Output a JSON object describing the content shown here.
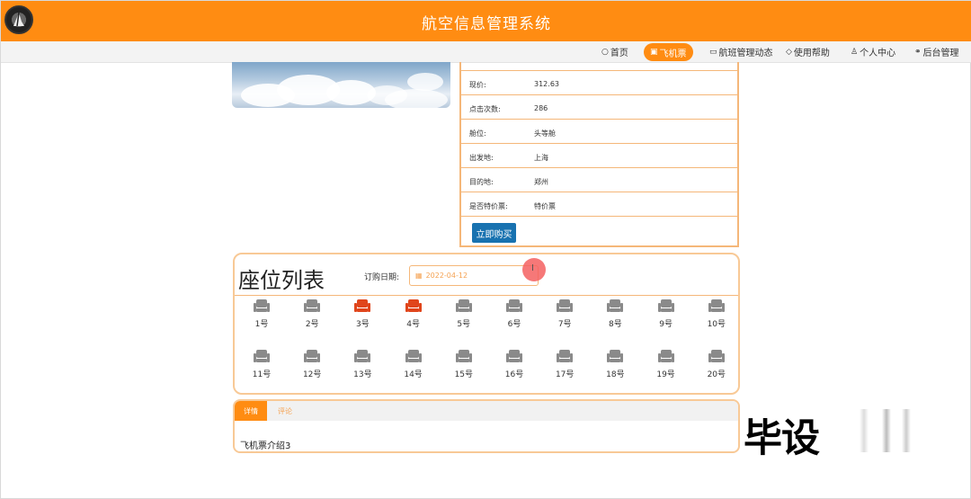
{
  "header": {
    "title": "航空信息管理系统",
    "brand_color": "#ff8c12"
  },
  "nav": {
    "items": [
      {
        "label": "首页",
        "icon": "home-icon"
      },
      {
        "label": "飞机票",
        "icon": "ticket-icon",
        "active": true
      },
      {
        "label": "航班管理动态",
        "icon": "mail-icon"
      },
      {
        "label": "使用帮助",
        "icon": "tag-icon"
      },
      {
        "label": "个人中心",
        "icon": "user-icon"
      },
      {
        "label": "后台管理",
        "icon": "link-icon"
      }
    ]
  },
  "ticket": {
    "rows": [
      {
        "key": "现价:",
        "value": "312.63"
      },
      {
        "key": "点击次数:",
        "value": "286"
      },
      {
        "key": "舱位:",
        "value": "头等舱"
      },
      {
        "key": "出发地:",
        "value": "上海"
      },
      {
        "key": "目的地:",
        "value": "郑州"
      },
      {
        "key": "是否特价票:",
        "value": "特价票"
      }
    ],
    "buy_label": "立即购买",
    "buy_color": "#1872b0"
  },
  "seats": {
    "title": "座位列表",
    "date_label": "订购日期:",
    "date_value": "2022-04-12",
    "available_color": "#8a8a8a",
    "taken_color": "#e0451b",
    "cursor_glyph": "I",
    "items": [
      {
        "label": "1号",
        "taken": false
      },
      {
        "label": "2号",
        "taken": false
      },
      {
        "label": "3号",
        "taken": true
      },
      {
        "label": "4号",
        "taken": true
      },
      {
        "label": "5号",
        "taken": false
      },
      {
        "label": "6号",
        "taken": false
      },
      {
        "label": "7号",
        "taken": false
      },
      {
        "label": "8号",
        "taken": false
      },
      {
        "label": "9号",
        "taken": false
      },
      {
        "label": "10号",
        "taken": false
      },
      {
        "label": "11号",
        "taken": false
      },
      {
        "label": "12号",
        "taken": false
      },
      {
        "label": "13号",
        "taken": false
      },
      {
        "label": "14号",
        "taken": false
      },
      {
        "label": "15号",
        "taken": false
      },
      {
        "label": "16号",
        "taken": false
      },
      {
        "label": "17号",
        "taken": false
      },
      {
        "label": "18号",
        "taken": false
      },
      {
        "label": "19号",
        "taken": false
      },
      {
        "label": "20号",
        "taken": false
      }
    ]
  },
  "detail": {
    "tabs": [
      {
        "label": "详情",
        "active": true
      },
      {
        "label": "评论",
        "active": false
      }
    ],
    "content": "飞机票介绍3"
  },
  "watermark": {
    "text": "毕设"
  }
}
